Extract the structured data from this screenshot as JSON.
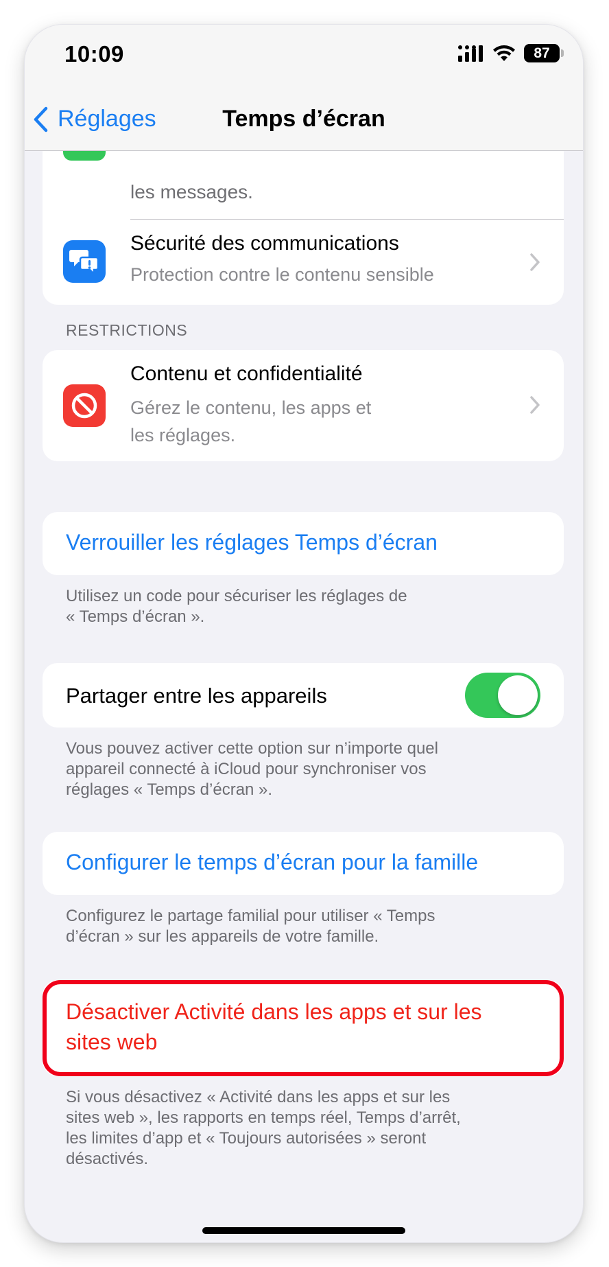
{
  "status_bar": {
    "time": "10:09",
    "battery": "87"
  },
  "nav": {
    "back_label": "Réglages",
    "title": "Temps d’écran"
  },
  "partial_row": {
    "subtitle": "les messages."
  },
  "communication_safety": {
    "title": "Sécurité des communications",
    "subtitle": "Protection contre le contenu sensible"
  },
  "restrictions": {
    "header": "RESTRICTIONS",
    "content_privacy": {
      "title": "Contenu et confidentialité",
      "subtitle_line1": "Gérez le contenu, les apps et",
      "subtitle_line2": "les réglages."
    }
  },
  "lock_settings": {
    "label": "Verrouiller les réglages Temps d’écran",
    "footer_line1": "Utilisez un code pour sécuriser les réglages de",
    "footer_line2": "« Temps d’écran »."
  },
  "share_devices": {
    "label": "Partager entre les appareils",
    "enabled": true,
    "footer_line1": "Vous pouvez activer cette option sur n’importe quel",
    "footer_line2": "appareil connecté à iCloud pour synchroniser vos",
    "footer_line3": "réglages « Temps d’écran »."
  },
  "family": {
    "label": "Configurer le temps d’écran pour la famille",
    "footer_line1": "Configurez le partage familial pour utiliser « Temps",
    "footer_line2": "d’écran » sur les appareils de votre famille."
  },
  "disable_activity": {
    "label_line1": "Désactiver Activité dans les apps et sur les",
    "label_line2": "sites web",
    "footer_line1": "Si vous désactivez « Activité dans les apps et sur les",
    "footer_line2": "sites web », les rapports en temps réel, Temps d’arrêt,",
    "footer_line3": "les limites d’app et « Toujours autorisées » seront",
    "footer_line4": "désactivés."
  },
  "colors": {
    "accent_blue": "#1a7ef2",
    "destructive_red": "#f0241a",
    "toggle_green": "#34c759",
    "highlight_red": "#f0001a"
  },
  "icons": {
    "communication_safety": "chat-bubbles-exclamation-icon",
    "content_privacy": "no-entry-icon"
  }
}
